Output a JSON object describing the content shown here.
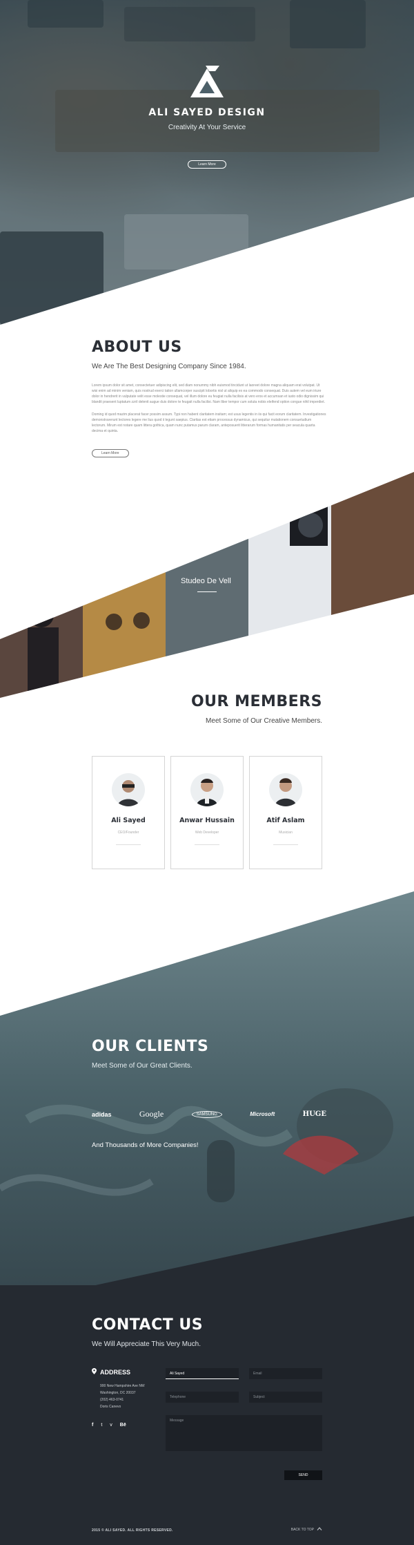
{
  "hero": {
    "title": "ALI SAYED DESIGN",
    "tagline": "Creativity At Your Service",
    "button": "Learn More",
    "logo_icon": "triangle-logo-icon"
  },
  "about": {
    "title": "ABOUT US",
    "subtitle": "We Are The Best Designing Company Since 1984.",
    "paragraph_1": "Lorem ipsum dolor sit amet, consectetuer adipiscing elit, sed diam nonummy nibh euismod tincidunt ut laoreet dolore magna aliquam erat volutpat. Ut wisi enim ad minim veniam, quis nostrud exerci tation ullamcorper suscipit lobortis nisl ut aliquip ex ea commodo consequat. Duis autem vel eum iriure dolor in hendrerit in vulputate velit esse molestie consequat, vel illum dolore eu feugiat nulla facilisis at vero eros et accumsan et iusto odio dignissim qui blandit praesent luptatum zzril delenit augue duis dolore te feugait nulla facilisi. Nam liber tempor cum soluta nobis eleifend option congue nihil imperdiet.",
    "paragraph_2": "Doming id quod mazim placerat facer possim assum. Typi non habent claritatem insitam; est usus legentis in iis qui facit eorum claritatem. Investigationes demonstraverunt lectores legere me lius quod ii legunt saepius. Claritas est etiam processus dynamicus, qui sequitur mutationem consuetudium lectorum. Mirum est notare quam littera gothica, quam nunc putamus parum claram, anteposuerit litterarum formas humanitatis per seacula quarta decima et quinta.",
    "button": "Learn More"
  },
  "strip": {
    "label": "Studeo De Vell"
  },
  "members": {
    "title": "OUR MEMBERS",
    "subtitle": "Meet Some of Our Creative Members.",
    "cards": [
      {
        "name": "Ali Sayed",
        "role": "CEO/Founder"
      },
      {
        "name": "Anwar Hussain",
        "role": "Web Developer"
      },
      {
        "name": "Atif Aslam",
        "role": "Musician"
      }
    ]
  },
  "clients": {
    "title": "OUR CLIENTS",
    "subtitle": "Meet Some of Our Great Clients.",
    "logos": [
      "adidas",
      "Google",
      "SAMSUNG",
      "Microsoft",
      "HUGE"
    ],
    "more": "And Thousands of More Companies!"
  },
  "contact": {
    "title": "CONTACT US",
    "subtitle": "We Will Appreciate This Very Much.",
    "address_title": "ADDRESS",
    "address_lines": [
      "900 New Hampshire Ave NW",
      "Washington, DC 20037",
      "(202) 463-0741",
      "Doris Canevo"
    ],
    "socials": [
      "f",
      "t",
      "v",
      "Bē"
    ],
    "fields": {
      "name_value": "Ali Sayed",
      "email_placeholder": "Email",
      "telephone_placeholder": "Telephone",
      "subject_placeholder": "Subject",
      "message_placeholder": "Message"
    },
    "send": "SEND"
  },
  "footer": {
    "copyright": "2015 © ALI SAYED. ALL RIGHTS RESERVED.",
    "back_to_top": "BACK TO TOP"
  }
}
